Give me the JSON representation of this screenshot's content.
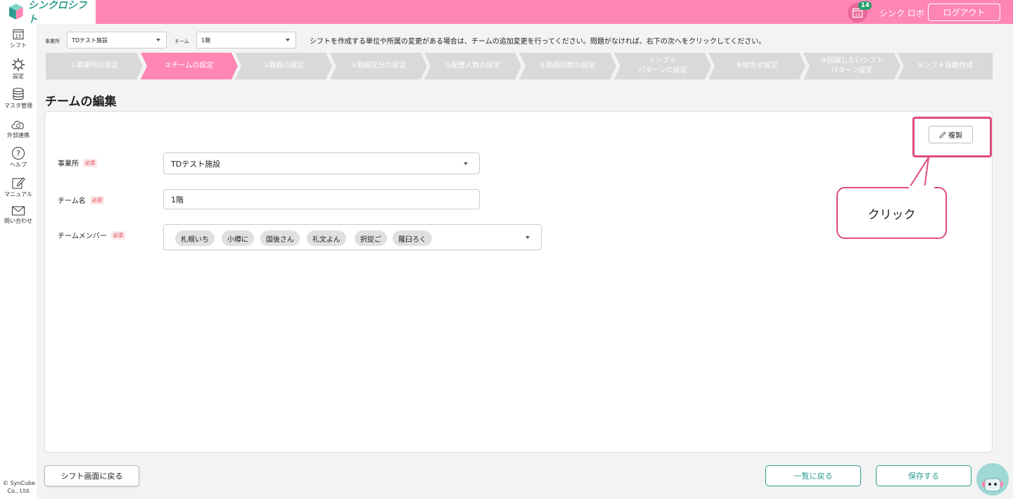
{
  "header": {
    "app_name": "シンクロシフト",
    "calendar_day": "15",
    "notification_count": "14",
    "user_name": "シンク ロボ",
    "logout_label": "ログアウト",
    "brand_color": "#ff86b4"
  },
  "sidebar": {
    "items": [
      {
        "label": "シフト",
        "icon": "calendar-icon"
      },
      {
        "label": "設定",
        "icon": "gear-icon"
      },
      {
        "label": "マスタ管理",
        "icon": "database-icon"
      },
      {
        "label": "外部連携",
        "icon": "cloud-sync-icon"
      },
      {
        "label": "ヘルプ",
        "icon": "help-icon"
      },
      {
        "label": "マニュアル",
        "icon": "edit-icon"
      },
      {
        "label": "問い合わせ",
        "icon": "mail-icon"
      }
    ],
    "copyright": "© SynCube Co., Ltd."
  },
  "filters": {
    "office_label": "事業所",
    "office_value": "TDテスト施設",
    "team_label": "チーム",
    "team_value": "1階",
    "notice": "シフトを作成する単位や所属の変更がある場合は、チームの追加変更を行ってください。問題がなければ、右下の次へをクリックしてください。"
  },
  "steps": [
    {
      "label": "①事業所の設定",
      "active": false
    },
    {
      "label": "②チームの設定",
      "active": true
    },
    {
      "label": "③職員の設定",
      "active": false
    },
    {
      "label": "④勤務区分の設定",
      "active": false
    },
    {
      "label": "⑤配置人数の設定",
      "active": false
    },
    {
      "label": "⑥勤務回数の設定",
      "active": false
    },
    {
      "label": "⑦シフト\nパターンの設定",
      "active": false
    },
    {
      "label": "⑧組合せ設定",
      "active": false
    },
    {
      "label": "⑨回避したいシフト\nパターン設定",
      "active": false
    },
    {
      "label": "⑩シフト自動作成",
      "active": false
    }
  ],
  "page_title": "チームの編集",
  "form": {
    "copy_button": "複製",
    "required_tag": "必須",
    "office": {
      "label": "事業所",
      "value": "TDテスト施設"
    },
    "team_name": {
      "label": "チーム名",
      "value": "1階"
    },
    "members": {
      "label": "チームメンバー",
      "chips": [
        "札幌いち",
        "小樽に",
        "国後さん",
        "礼文よん",
        "択捉ご",
        "羅臼ろく"
      ]
    }
  },
  "callout": "クリック",
  "footer": {
    "back_label": "シフト画面に戻る",
    "list_label": "一覧に戻る",
    "save_label": "保存する"
  }
}
